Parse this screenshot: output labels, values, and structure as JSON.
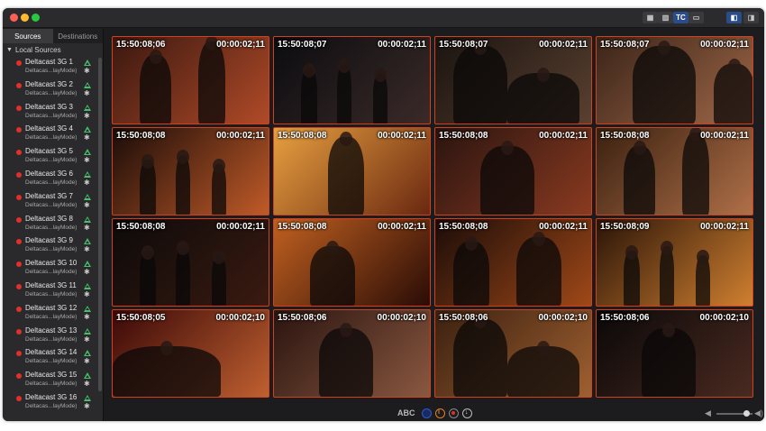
{
  "toolbar": {
    "buttons": [
      {
        "name": "layout-grid-icon",
        "label": "▦"
      },
      {
        "name": "audio-meters-icon",
        "label": "▥"
      },
      {
        "name": "timecode-toggle",
        "label": "TC"
      },
      {
        "name": "safe-area-icon",
        "label": "▭"
      },
      {
        "name": "sidebar-left-toggle",
        "label": "◧"
      },
      {
        "name": "sidebar-right-toggle",
        "label": "◨"
      }
    ]
  },
  "sidebar": {
    "tabs": [
      {
        "label": "Sources",
        "active": true
      },
      {
        "label": "Destinations",
        "active": false
      }
    ],
    "section_title": "Local Sources",
    "sources": [
      {
        "name": "Deltacast 3G 1",
        "sub": "Deltacas...layMode)"
      },
      {
        "name": "Deltacast 3G 2",
        "sub": "Deltacas...layMode)"
      },
      {
        "name": "Deltacast 3G 3",
        "sub": "Deltacas...layMode)"
      },
      {
        "name": "Deltacast 3G 4",
        "sub": "Deltacas...layMode)"
      },
      {
        "name": "Deltacast 3G 5",
        "sub": "Deltacas...layMode)"
      },
      {
        "name": "Deltacast 3G 6",
        "sub": "Deltacas...layMode)"
      },
      {
        "name": "Deltacast 3G 7",
        "sub": "Deltacas...layMode)"
      },
      {
        "name": "Deltacast 3G 8",
        "sub": "Deltacas...layMode)"
      },
      {
        "name": "Deltacast 3G 9",
        "sub": "Deltacas...layMode)"
      },
      {
        "name": "Deltacast 3G 10",
        "sub": "Deltacas...layMode)"
      },
      {
        "name": "Deltacast 3G 11",
        "sub": "Deltacas...layMode)"
      },
      {
        "name": "Deltacast 3G 12",
        "sub": "Deltacas...layMode)"
      },
      {
        "name": "Deltacast 3G 13",
        "sub": "Deltacas...layMode)"
      },
      {
        "name": "Deltacast 3G 14",
        "sub": "Deltacas...layMode)"
      },
      {
        "name": "Deltacast 3G 15",
        "sub": "Deltacas...layMode)"
      },
      {
        "name": "Deltacast 3G 16",
        "sub": "Deltacas...layMode)"
      }
    ]
  },
  "tiles": [
    {
      "tc": "15:50:08;06",
      "dur": "00:00:02;11",
      "bg": [
        "#3a1810",
        "#b04a28"
      ],
      "scene": "guitar"
    },
    {
      "tc": "15:50:08;07",
      "dur": "00:00:02;11",
      "bg": [
        "#0c0c10",
        "#3a2a28"
      ],
      "scene": "stage"
    },
    {
      "tc": "15:50:08;07",
      "dur": "00:00:02;11",
      "bg": [
        "#1a1410",
        "#5a4030"
      ],
      "scene": "bass"
    },
    {
      "tc": "15:50:08;07",
      "dur": "00:00:02;11",
      "bg": [
        "#3a2418",
        "#a06848"
      ],
      "scene": "suit"
    },
    {
      "tc": "15:50:08;08",
      "dur": "00:00:02;11",
      "bg": [
        "#1a0c08",
        "#c05a28"
      ],
      "scene": "stage"
    },
    {
      "tc": "15:50:08;08",
      "dur": "00:00:02;11",
      "bg": [
        "#e8a040",
        "#6a2810"
      ],
      "scene": "spot"
    },
    {
      "tc": "15:50:08;08",
      "dur": "00:00:02;11",
      "bg": [
        "#2a1410",
        "#8a3a20"
      ],
      "scene": "singer"
    },
    {
      "tc": "15:50:08;08",
      "dur": "00:00:02;11",
      "bg": [
        "#3a2010",
        "#b07048"
      ],
      "scene": "guitar"
    },
    {
      "tc": "15:50:08;08",
      "dur": "00:00:02;11",
      "bg": [
        "#0c0a0a",
        "#3a1a10"
      ],
      "scene": "stage"
    },
    {
      "tc": "15:50:08;08",
      "dur": "00:00:02;11",
      "bg": [
        "#c06020",
        "#2a0c06"
      ],
      "scene": "mic"
    },
    {
      "tc": "15:50:08;08",
      "dur": "00:00:02;11",
      "bg": [
        "#1a0c08",
        "#a04818"
      ],
      "scene": "band"
    },
    {
      "tc": "15:50:08;09",
      "dur": "00:00:02;11",
      "bg": [
        "#2a1408",
        "#d08030"
      ],
      "scene": "stage"
    },
    {
      "tc": "15:50:08;05",
      "dur": "00:00:02;10",
      "bg": [
        "#3a0808",
        "#c06030"
      ],
      "scene": "piano"
    },
    {
      "tc": "15:50:08;06",
      "dur": "00:00:02;10",
      "bg": [
        "#2a1410",
        "#8a5840"
      ],
      "scene": "singer"
    },
    {
      "tc": "15:50:08;06",
      "dur": "00:00:02;10",
      "bg": [
        "#3a2010",
        "#a06030"
      ],
      "scene": "bass"
    },
    {
      "tc": "15:50:08;06",
      "dur": "00:00:02;10",
      "bg": [
        "#0a0808",
        "#4a2a20"
      ],
      "scene": "singer"
    }
  ],
  "bottombar": {
    "abc_label": "ABC",
    "colors": {
      "accent": "#2a5ad0",
      "record": "#e0302a",
      "pause": "#e0802a"
    }
  },
  "colors": {
    "tile_border": "#d2401d",
    "source_dot": "#e0302a",
    "status_green": "#48c06b"
  }
}
